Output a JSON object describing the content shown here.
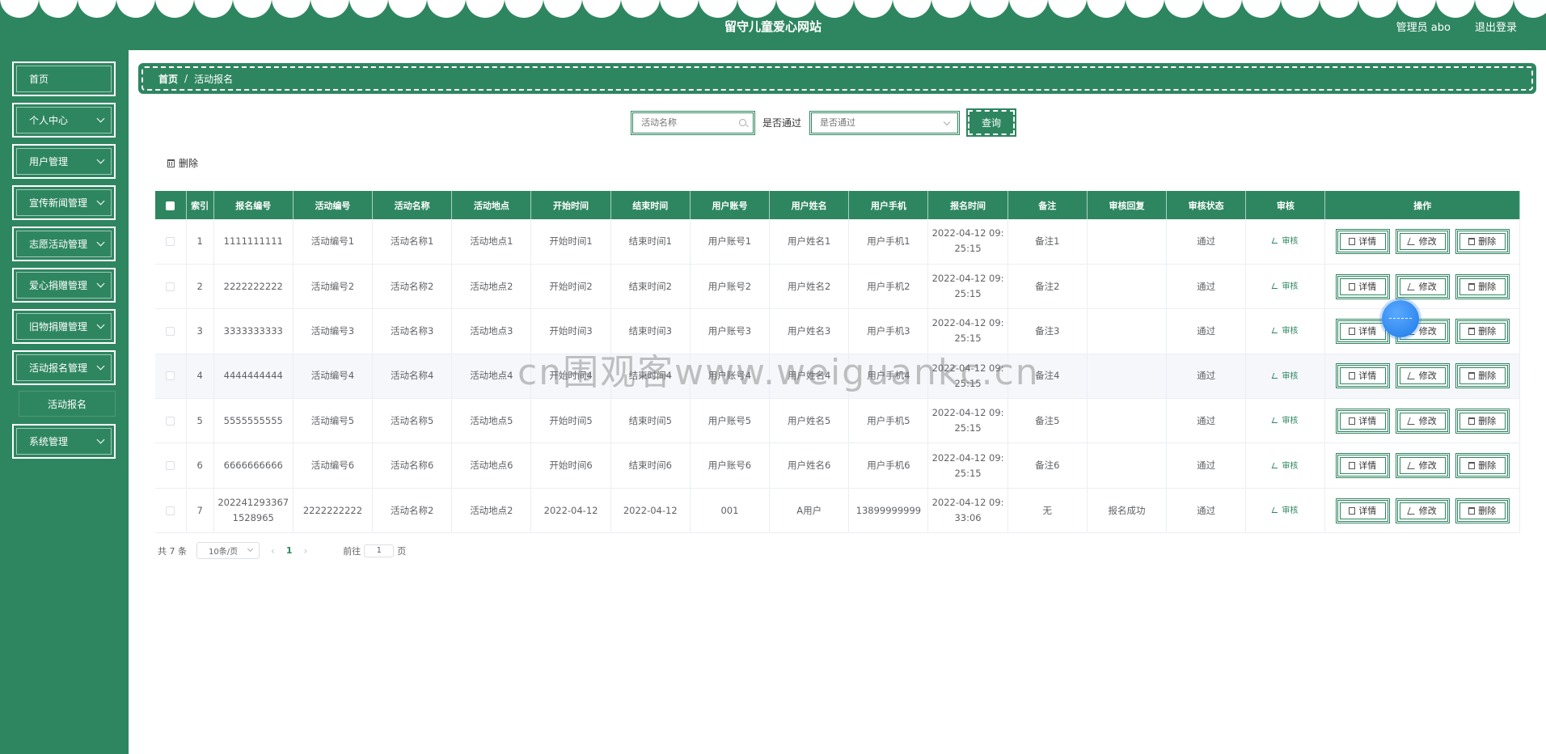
{
  "header": {
    "title": "留守儿童爱心网站",
    "user": "管理员 abo",
    "logout": "退出登录"
  },
  "sidebar": {
    "items": [
      {
        "label": "首页",
        "expandable": false
      },
      {
        "label": "个人中心",
        "expandable": true
      },
      {
        "label": "用户管理",
        "expandable": true
      },
      {
        "label": "宣传新闻管理",
        "expandable": true
      },
      {
        "label": "志愿活动管理",
        "expandable": true
      },
      {
        "label": "爱心捐赠管理",
        "expandable": true
      },
      {
        "label": "旧物捐赠管理",
        "expandable": true
      },
      {
        "label": "活动报名管理",
        "expandable": true
      },
      {
        "label": "系统管理",
        "expandable": true
      }
    ],
    "submenu": {
      "label": "活动报名"
    }
  },
  "breadcrumb": {
    "home": "首页",
    "sep": "/",
    "current": "活动报名"
  },
  "search": {
    "name_placeholder": "活动名称",
    "pass_label": "是否通过",
    "pass_placeholder": "是否通过",
    "query_button": "查询"
  },
  "toolbar": {
    "delete_label": "删除"
  },
  "table": {
    "headers": [
      "",
      "索引",
      "报名编号",
      "活动编号",
      "活动名称",
      "活动地点",
      "开始时间",
      "结束时间",
      "用户账号",
      "用户姓名",
      "用户手机",
      "报名时间",
      "备注",
      "审核回复",
      "审核状态",
      "审核",
      "操作"
    ],
    "audit_label": "审核",
    "actions": {
      "detail": "详情",
      "edit": "修改",
      "delete": "删除"
    },
    "rows": [
      {
        "index": "1",
        "reg_no": "1111111111",
        "act_no": "活动编号1",
        "act_name": "活动名称1",
        "place": "活动地点1",
        "start": "开始时间1",
        "end": "结束时间1",
        "account": "用户账号1",
        "username": "用户姓名1",
        "phone": "用户手机1",
        "reg_time": "2022-04-12 09:25:15",
        "remark": "备注1",
        "reply": "",
        "status": "通过"
      },
      {
        "index": "2",
        "reg_no": "2222222222",
        "act_no": "活动编号2",
        "act_name": "活动名称2",
        "place": "活动地点2",
        "start": "开始时间2",
        "end": "结束时间2",
        "account": "用户账号2",
        "username": "用户姓名2",
        "phone": "用户手机2",
        "reg_time": "2022-04-12 09:25:15",
        "remark": "备注2",
        "reply": "",
        "status": "通过"
      },
      {
        "index": "3",
        "reg_no": "3333333333",
        "act_no": "活动编号3",
        "act_name": "活动名称3",
        "place": "活动地点3",
        "start": "开始时间3",
        "end": "结束时间3",
        "account": "用户账号3",
        "username": "用户姓名3",
        "phone": "用户手机3",
        "reg_time": "2022-04-12 09:25:15",
        "remark": "备注3",
        "reply": "",
        "status": "通过"
      },
      {
        "index": "4",
        "reg_no": "4444444444",
        "act_no": "活动编号4",
        "act_name": "活动名称4",
        "place": "活动地点4",
        "start": "开始时间4",
        "end": "结束时间4",
        "account": "用户账号4",
        "username": "用户姓名4",
        "phone": "用户手机4",
        "reg_time": "2022-04-12 09:25:15",
        "remark": "备注4",
        "reply": "",
        "status": "通过"
      },
      {
        "index": "5",
        "reg_no": "5555555555",
        "act_no": "活动编号5",
        "act_name": "活动名称5",
        "place": "活动地点5",
        "start": "开始时间5",
        "end": "结束时间5",
        "account": "用户账号5",
        "username": "用户姓名5",
        "phone": "用户手机5",
        "reg_time": "2022-04-12 09:25:15",
        "remark": "备注5",
        "reply": "",
        "status": "通过"
      },
      {
        "index": "6",
        "reg_no": "6666666666",
        "act_no": "活动编号6",
        "act_name": "活动名称6",
        "place": "活动地点6",
        "start": "开始时间6",
        "end": "结束时间6",
        "account": "用户账号6",
        "username": "用户姓名6",
        "phone": "用户手机6",
        "reg_time": "2022-04-12 09:25:15",
        "remark": "备注6",
        "reply": "",
        "status": "通过"
      },
      {
        "index": "7",
        "reg_no": "2022412933671528965",
        "act_no": "2222222222",
        "act_name": "活动名称2",
        "place": "活动地点2",
        "start": "2022-04-12",
        "end": "2022-04-12",
        "account": "001",
        "username": "A用户",
        "phone": "13899999999",
        "reg_time": "2022-04-12 09:33:06",
        "remark": "无",
        "reply": "报名成功",
        "status": "通过"
      }
    ]
  },
  "pagination": {
    "total": "共 7 条",
    "page_size": "10条/页",
    "prev": "‹",
    "current": "1",
    "next": "›",
    "goto_prefix": "前往",
    "goto_value": "1",
    "goto_suffix": "页"
  },
  "watermark": "cn围观客www.weiguankc.cn",
  "colors": {
    "primary": "#2e8660",
    "accent_ball": "#1f7be8"
  }
}
